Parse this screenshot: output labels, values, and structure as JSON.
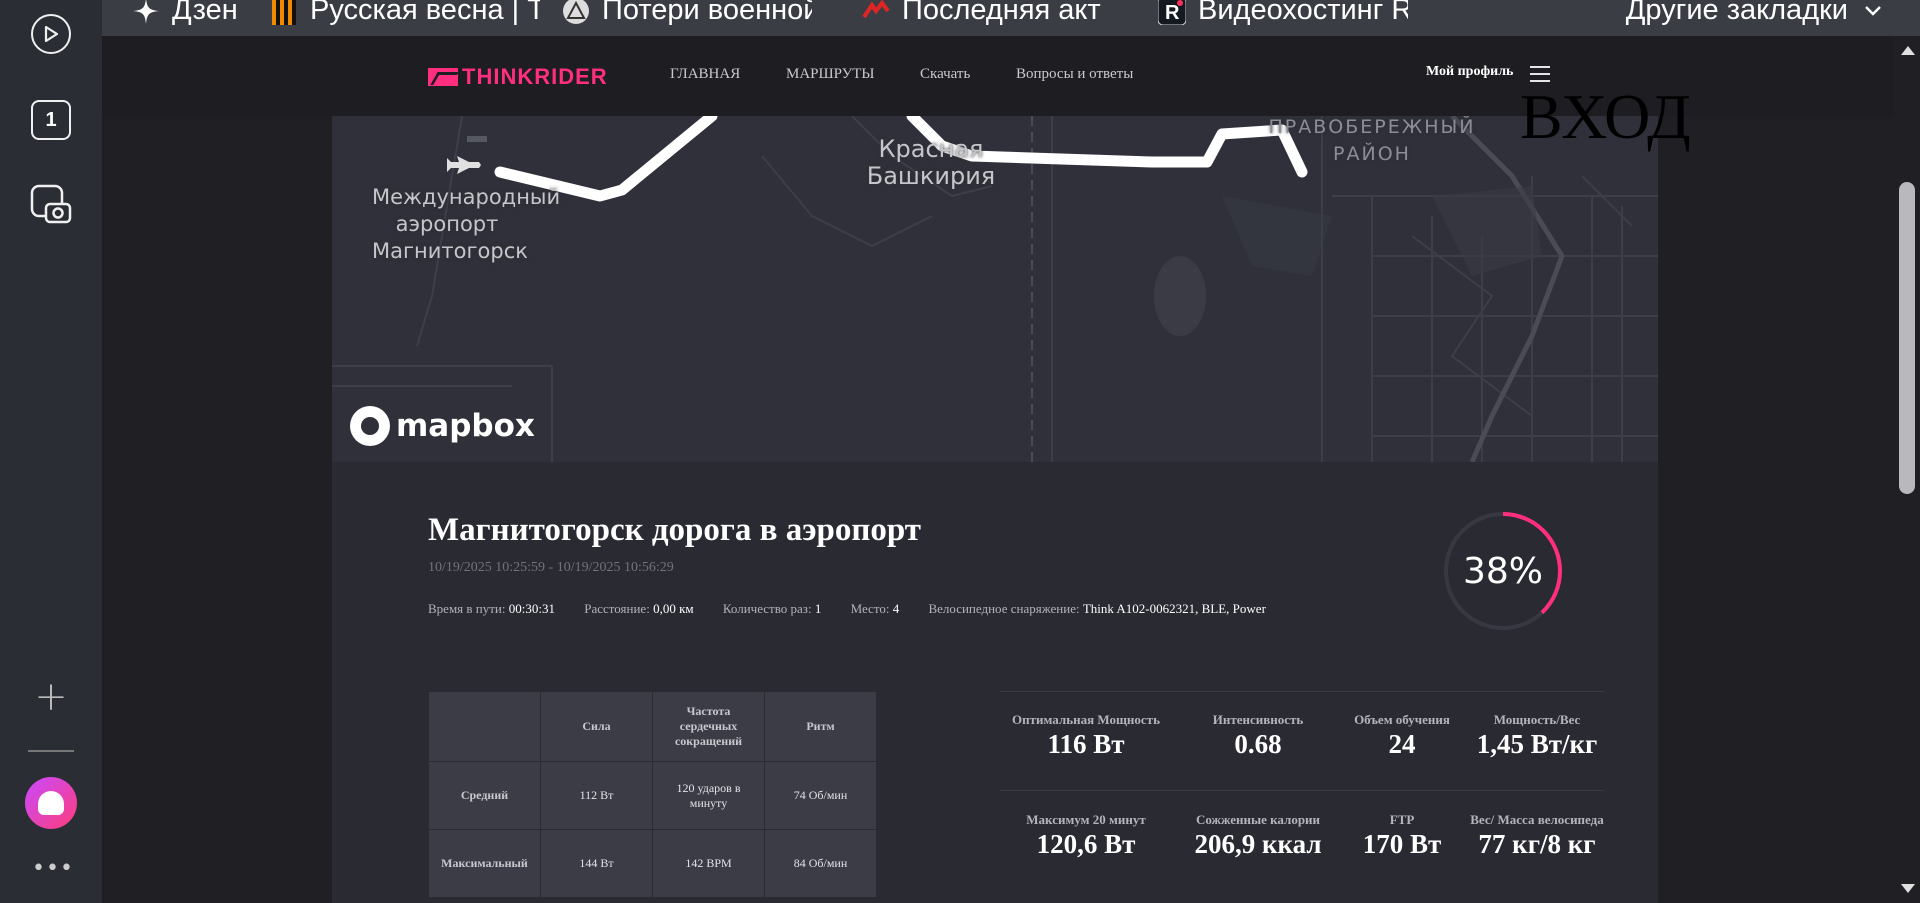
{
  "bookmarks": {
    "items": [
      {
        "label": "Дзен",
        "icon": "dzen-star-icon"
      },
      {
        "label": "Русская весна | То",
        "icon": "ribbon-icon"
      },
      {
        "label": "Потери военной т",
        "icon": "triangle-icon"
      },
      {
        "label": "Последняя активн",
        "icon": "red-flag-icon"
      },
      {
        "label": "Видеохостинг RU",
        "icon": "rutube-r-icon"
      }
    ],
    "other": "Другие закладки"
  },
  "sidebar": {
    "tab_count": "1"
  },
  "nav": {
    "logo": "THINKRIDER",
    "links": [
      "ГЛАВНАЯ",
      "МАРШРУТЫ",
      "Скачать",
      "Вопросы и ответы"
    ],
    "profile": "Мой профиль",
    "login": "ВХОД"
  },
  "map": {
    "labels": {
      "airport": "Международный аэропорт Магнитогорск",
      "district1": "Красная Башкирия",
      "district2": "ПРАВОБЕРЕЖНЫЙ РАЙОН"
    },
    "attribution": "mapbox"
  },
  "ride": {
    "title": "Магнитогорск дорога в аэропорт",
    "dates": "10/19/2025 10:25:59 - 10/19/2025 10:56:29",
    "meta": [
      {
        "label": "Время в пути:",
        "value": "00:30:31"
      },
      {
        "label": "Расстояние:",
        "value": "0,00 км"
      },
      {
        "label": "Количество раз:",
        "value": "1"
      },
      {
        "label": "Место:",
        "value": "4"
      },
      {
        "label": "Велосипедное снаряжение:",
        "value": "Think A102-0062321, BLE, Power"
      }
    ],
    "progress_text": "38%",
    "progress": 0.38,
    "accent": "#ff2e7e"
  },
  "table": {
    "headers": [
      "",
      "Сила",
      "Частота сердечных сокращений",
      "Ритм"
    ],
    "rows": [
      {
        "label": "Средний",
        "cells": [
          "112 Вт",
          "120 ударов в минуту",
          "74 Об/мин"
        ]
      },
      {
        "label": "Максимальный",
        "cells": [
          "144 Вт",
          "142 BPM",
          "84 Об/мин"
        ]
      }
    ]
  },
  "metrics": [
    {
      "label": "Оптимальная Мощность",
      "value": "116 Вт"
    },
    {
      "label": "Интенсивность",
      "value": "0.68"
    },
    {
      "label": "Объем обучения",
      "value": "24"
    },
    {
      "label": "Мощность/Вес",
      "value": "1,45 Вт/кг"
    },
    {
      "label": "Максимум 20 минут",
      "value": "120,6 Вт"
    },
    {
      "label": "Сожженные калории",
      "value": "206,9 ккал"
    },
    {
      "label": "FTP",
      "value": "170 Вт"
    },
    {
      "label": "Вес/ Масса велосипеда",
      "value": "77 кг/8 кг"
    }
  ]
}
